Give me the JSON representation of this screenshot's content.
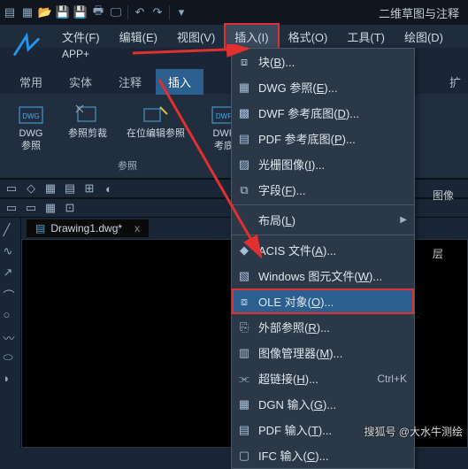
{
  "qat_title": "二维草图与注释",
  "menubar": [
    "文件(F)",
    "编辑(E)",
    "视图(V)",
    "插入(I)",
    "格式(O)",
    "工具(T)",
    "绘图(D)"
  ],
  "menubar_active_index": 3,
  "appplus": "APP+",
  "tabs": [
    "常用",
    "实体",
    "注释",
    "插入"
  ],
  "tabs_active_index": 3,
  "tab_ext": "扩",
  "ribbon": {
    "panel1": {
      "btn1": "DWG\n参照",
      "btn2": "参照剪裁",
      "btn3": "在位编辑参照",
      "btn4": "DWF\n考底",
      "label": "参照"
    },
    "side_labels": [
      "图像",
      "层"
    ]
  },
  "doctab": {
    "name": "Drawing1.dwg*",
    "close": "x"
  },
  "dropdown": [
    {
      "icon": "block",
      "text": "块(B)...",
      "mn": "B"
    },
    {
      "icon": "dwg",
      "text": "DWG 参照(E)...",
      "mn": "E"
    },
    {
      "icon": "dwf",
      "text": "DWF 参考底图(D)...",
      "mn": "D"
    },
    {
      "icon": "pdf",
      "text": "PDF 参考底图(P)...",
      "mn": "P"
    },
    {
      "icon": "raster",
      "text": "光栅图像(I)...",
      "mn": "I"
    },
    {
      "icon": "field",
      "text": "字段(F)...",
      "mn": "F"
    },
    {
      "sep": true
    },
    {
      "icon": "",
      "text": "布局(L)",
      "mn": "L",
      "sub": true
    },
    {
      "sep": true
    },
    {
      "icon": "acis",
      "text": "ACIS 文件(A)...",
      "mn": "A"
    },
    {
      "icon": "wmf",
      "text": "Windows 图元文件(W)...",
      "mn": "W"
    },
    {
      "icon": "ole",
      "text": "OLE 对象(O)...",
      "mn": "O",
      "hl": true
    },
    {
      "icon": "xref",
      "text": "外部参照(R)...",
      "mn": "R"
    },
    {
      "icon": "imgmgr",
      "text": "图像管理器(M)...",
      "mn": "M"
    },
    {
      "icon": "link",
      "text": "超链接(H)...",
      "mn": "H",
      "short": "Ctrl+K"
    },
    {
      "icon": "dgn",
      "text": "DGN 输入(G)...",
      "mn": "G"
    },
    {
      "icon": "pdfin",
      "text": "PDF 输入(T)...",
      "mn": "T"
    },
    {
      "icon": "ifc",
      "text": "IFC 输入(C)...",
      "mn": "C"
    }
  ],
  "watermark": "搜狐号 @大水牛测绘"
}
